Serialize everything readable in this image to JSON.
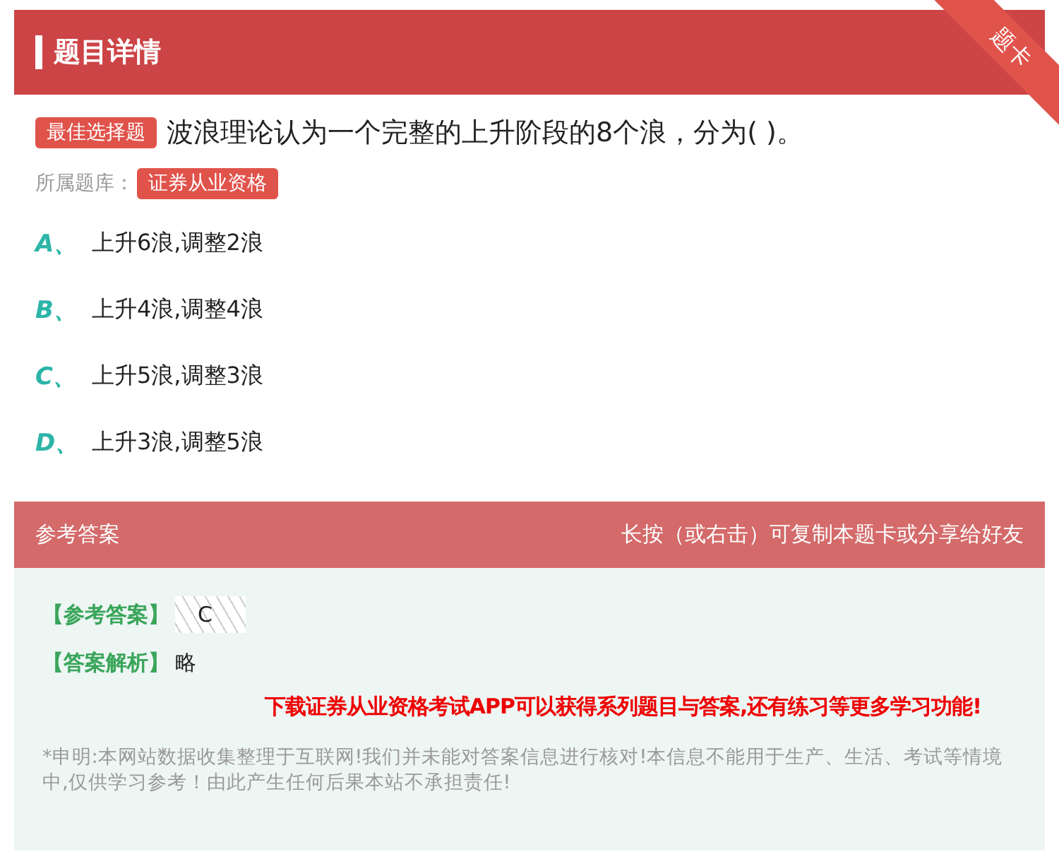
{
  "header": {
    "title": "题目详情",
    "corner_ribbon": "题卡"
  },
  "question": {
    "type_tag": "最佳选择题",
    "text": "波浪理论认为一个完整的上升阶段的8个浪，分为( )。",
    "bank_label": "所属题库：",
    "bank_tag": "证券从业资格"
  },
  "options": [
    {
      "letter": "A、",
      "text": "上升6浪,调整2浪"
    },
    {
      "letter": "B、",
      "text": "上升4浪,调整4浪"
    },
    {
      "letter": "C、",
      "text": "上升5浪,调整3浪"
    },
    {
      "letter": "D、",
      "text": "上升3浪,调整5浪"
    }
  ],
  "answer_panel": {
    "title": "参考答案",
    "hint": "长按（或右击）可复制本题卡或分享给好友",
    "answer_label": "【参考答案】",
    "answer": "C",
    "analysis_label": "【答案解析】",
    "analysis": "略",
    "promo": "下载证券从业资格考试APP可以获得系列题目与答案,还有练习等更多学习功能!",
    "disclaimer": "*申明:本网站数据收集整理于互联网!我们并未能对答案信息进行核对!本信息不能用于生产、生活、考试等情境中,仅供学习参考！由此产生任何后果本站不承担责任!"
  }
}
